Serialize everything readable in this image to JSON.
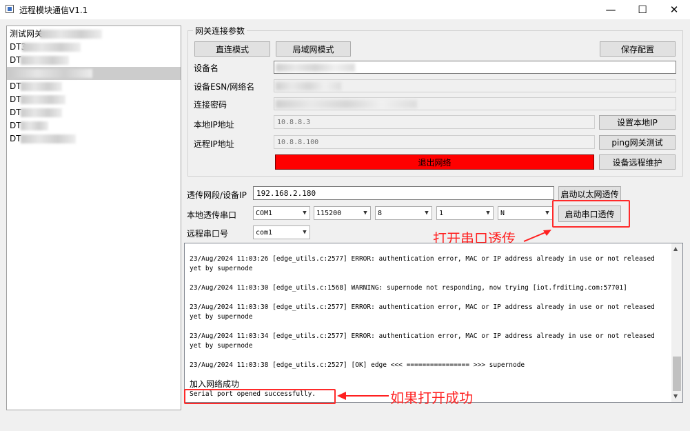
{
  "window": {
    "title": "远程模块通信V1.1",
    "controls": [
      "—",
      "☐",
      "✕"
    ]
  },
  "device_list": {
    "items": [
      {
        "label": "测试网关"
      },
      {
        "label": "DT3"
      },
      {
        "label": "DT"
      },
      {
        "label": ""
      },
      {
        "label": "DT"
      },
      {
        "label": "DT"
      },
      {
        "label": "DT"
      },
      {
        "label": "DT"
      },
      {
        "label": "DT"
      }
    ]
  },
  "gateway": {
    "group_title": "网关连接参数",
    "direct_mode": "直连模式",
    "lan_mode": "局域网模式",
    "save_config": "保存配置",
    "device_name_label": "设备名",
    "esn_label": "设备ESN/网络名",
    "password_label": "连接密码",
    "local_ip_label": "本地IP地址",
    "local_ip_value": "10.8.8.3",
    "set_local_ip": "设置本地IP",
    "remote_ip_label": "远程IP地址",
    "remote_ip_value": "10.8.8.100",
    "ping_test": "ping网关测试",
    "exit_network": "退出网络",
    "set_remote_maintenance": "设备远程维护"
  },
  "transparent": {
    "segment_label": "透传网段/设备IP",
    "segment_value": "192.168.2.180",
    "start_ethernet": "启动以太网透传",
    "local_serial_label": "本地透传串口",
    "com_port": "COM1",
    "baud_rate": "115200",
    "data_bits": "8",
    "stop_bits": "1",
    "parity": "N",
    "start_serial": "启动串口透传",
    "remote_serial_label": "远程串口号",
    "remote_com": "com1"
  },
  "log": {
    "lines": [
      "23/Aug/2024 11:03:26 [edge_utils.c:2577] ERROR: authentication error, MAC or IP address already in use or not released yet by supernode",
      "23/Aug/2024 11:03:30 [edge_utils.c:1568] WARNING: supernode not responding, now trying [iot.frditing.com:57701]",
      "23/Aug/2024 11:03:30 [edge_utils.c:2577] ERROR: authentication error, MAC or IP address already in use or not released yet by supernode",
      "23/Aug/2024 11:03:34 [edge_utils.c:2577] ERROR: authentication error, MAC or IP address already in use or not released yet by supernode",
      "23/Aug/2024 11:03:38 [edge_utils.c:2527] [OK] edge <<< ================ >>> supernode"
    ],
    "joined": "加入网络成功",
    "serial_opened": "Serial port opened successfully."
  },
  "annotations": {
    "open_serial": "打开串口透传",
    "if_success": "如果打开成功",
    "color": "#ff2020"
  }
}
